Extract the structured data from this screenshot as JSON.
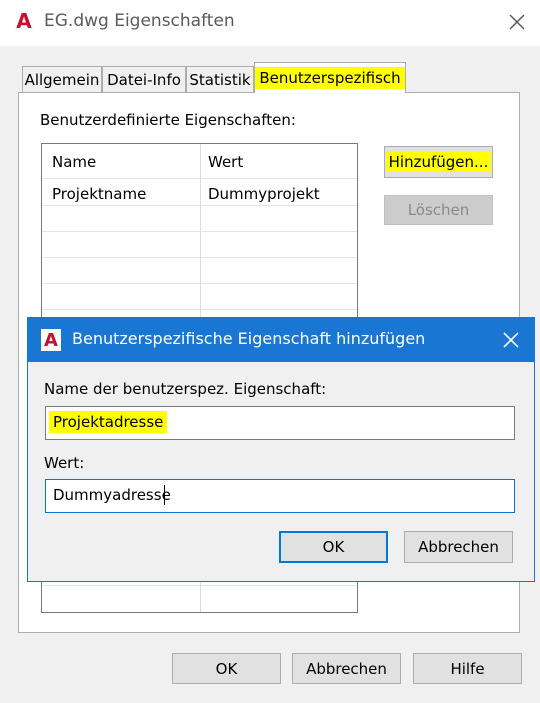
{
  "window": {
    "title": "EG.dwg Eigenschaften",
    "app_logo": "A",
    "app_icon": "autocad-logo-icon"
  },
  "tabs": [
    {
      "label": "Allgemein",
      "active": false
    },
    {
      "label": "Datei-Info",
      "active": false
    },
    {
      "label": "Statistik",
      "active": false
    },
    {
      "label": "Benutzerspezifisch",
      "active": true,
      "highlighted": true
    }
  ],
  "properties": {
    "section_label": "Benutzerdefinierte Eigenschaften:",
    "columns": [
      "Name",
      "Wert"
    ],
    "rows": [
      {
        "name": "Projektname",
        "value": "Dummyprojekt"
      }
    ],
    "add_label": "Hinzufügen...",
    "delete_label": "Löschen"
  },
  "footer": {
    "ok_label": "OK",
    "cancel_label": "Abbrechen",
    "help_label": "Hilfe"
  },
  "dialog": {
    "title": "Benutzerspezifische Eigenschaft hinzufügen",
    "name_label": "Name der benutzerspez. Eigenschaft:",
    "name_value": "Projektadresse",
    "value_label": "Wert:",
    "value_value": "Dummyadresse",
    "ok_label": "OK",
    "cancel_label": "Abbrechen"
  },
  "colors": {
    "highlight": "#ffff00",
    "dialog_title_bg": "#1976d2",
    "focus_border": "#0078d7",
    "logo_red": "#c8102e"
  }
}
